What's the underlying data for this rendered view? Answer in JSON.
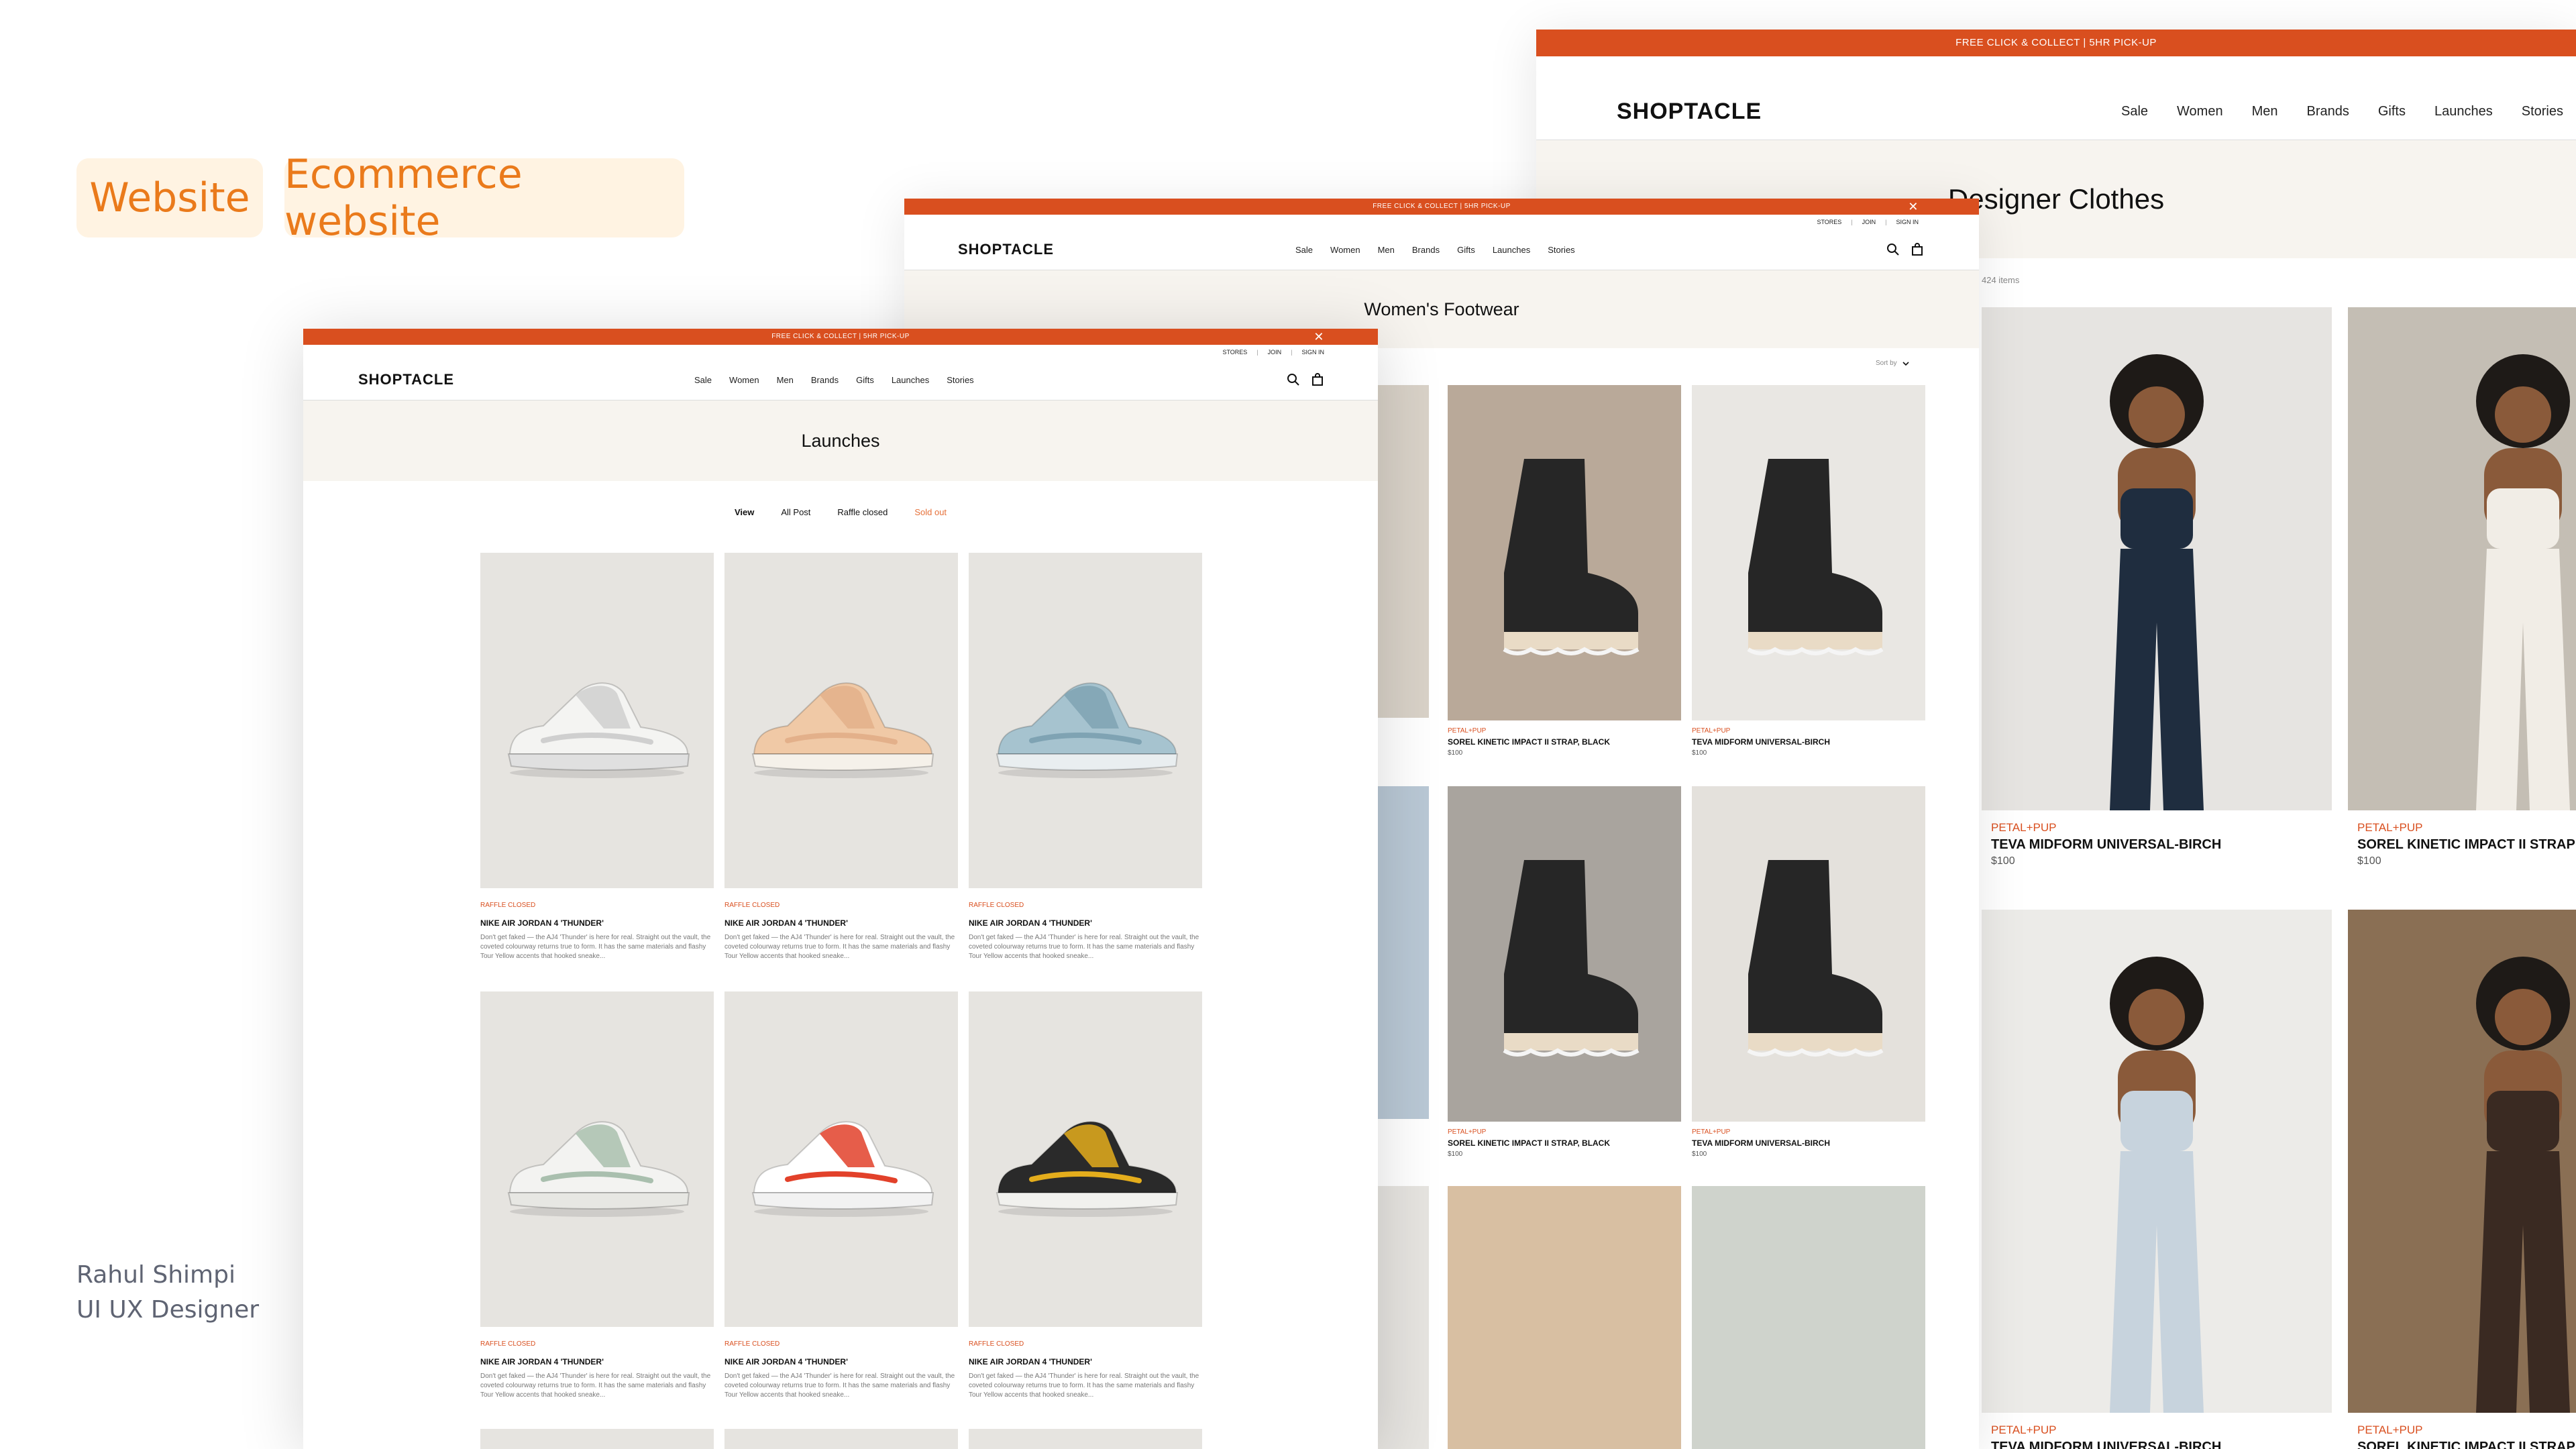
{
  "tags": [
    "Website",
    "Ecommerce website"
  ],
  "author": {
    "name": "Rahul Shimpi",
    "role": "UI UX Designer"
  },
  "store": {
    "promo": "FREE CLICK & COLLECT | 5HR PICK-UP",
    "logo": "SHOPTACLE",
    "util": [
      "STORES",
      "JOIN",
      "SIGN IN"
    ],
    "menu": [
      "Sale",
      "Women",
      "Men",
      "Brands",
      "Gifts",
      "Launches",
      "Stories"
    ]
  },
  "launches": {
    "title": "Launches",
    "filters": [
      "View",
      "All Post",
      "Raffle closed",
      "Sold out"
    ],
    "cards": [
      {
        "status": "RAFFLE CLOSED",
        "name": "NIKE AIR JORDAN 4 'THUNDER'",
        "desc": "Don't get faked — the AJ4 'Thunder' is here for real. Straight out the vault, the coveted colourway returns true to form. It has the same materials and flashy Tour Yellow accents that hooked sneake...",
        "shoe": "white",
        "colors": {
          "upper": "#f4f4f2",
          "accent": "#cfcfcf",
          "sole": "#e0e0e0"
        }
      },
      {
        "status": "RAFFLE CLOSED",
        "name": "NIKE AIR JORDAN 4 'THUNDER'",
        "desc": "Don't get faked — the AJ4 'Thunder' is here for real. Straight out the vault, the coveted colourway returns true to form. It has the same materials and flashy Tour Yellow accents that hooked sneake...",
        "shoe": "tan",
        "colors": {
          "upper": "#f0c9a6",
          "accent": "#e3b08a",
          "sole": "#f5f1ea"
        }
      },
      {
        "status": "RAFFLE CLOSED",
        "name": "NIKE AIR JORDAN 4 'THUNDER'",
        "desc": "Don't get faked — the AJ4 'Thunder' is here for real. Straight out the vault, the coveted colourway returns true to form. It has the same materials and flashy Tour Yellow accents that hooked sneake...",
        "shoe": "blue",
        "colors": {
          "upper": "#a6c3cf",
          "accent": "#7fa3b3",
          "sole": "#e9eef0"
        }
      },
      {
        "status": "RAFFLE CLOSED",
        "name": "NIKE AIR JORDAN 4 'THUNDER'",
        "desc": "Don't get faked — the AJ4 'Thunder' is here for real. Straight out the vault, the coveted colourway returns true to form. It has the same materials and flashy Tour Yellow accents that hooked sneake...",
        "shoe": "sage",
        "colors": {
          "upper": "#f3f3f1",
          "accent": "#a9bfae",
          "sole": "#e7e7e3"
        }
      },
      {
        "status": "RAFFLE CLOSED",
        "name": "NIKE AIR JORDAN 4 'THUNDER'",
        "desc": "Don't get faked — the AJ4 'Thunder' is here for real. Straight out the vault, the coveted colourway returns true to form. It has the same materials and flashy Tour Yellow accents that hooked sneake...",
        "shoe": "red",
        "colors": {
          "upper": "#ffffff",
          "accent": "#e2412a",
          "sole": "#f2f2f2"
        }
      },
      {
        "status": "RAFFLE CLOSED",
        "name": "NIKE AIR JORDAN 4 'THUNDER'",
        "desc": "Don't get faked — the AJ4 'Thunder' is here for real. Straight out the vault, the coveted colourway returns true to form. It has the same materials and flashy Tour Yellow accents that hooked sneake...",
        "shoe": "yellow",
        "colors": {
          "upper": "#2a2a2a",
          "accent": "#e4ad1c",
          "sole": "#f1f1ee"
        }
      }
    ]
  },
  "footwear": {
    "title": "Women's Footwear",
    "sort_label": "Sort by",
    "cards": [
      {
        "brand": "PETAL+PUP",
        "name": "SOREL KINETIC IMPACT II STRAP, BLACK",
        "price": "$100",
        "bg": "#b9a999"
      },
      {
        "brand": "PETAL+PUP",
        "name": "TEVA MIDFORM UNIVERSAL-BIRCH",
        "price": "$100",
        "bg": "#e9e7e3"
      },
      {
        "brand": "PETAL+PUP",
        "name": "SOREL KINETIC IMPACT II STRAP, BLACK",
        "price": "$100",
        "bg": "#a9a49e"
      },
      {
        "brand": "PETAL+PUP",
        "name": "TEVA MIDFORM UNIVERSAL-BIRCH",
        "price": "$100",
        "bg": "#e4e1dc"
      }
    ]
  },
  "designer": {
    "title": "Designer Clothes",
    "count": "424 items",
    "cards": [
      {
        "brand": "PETAL+PUP",
        "name": "TEVA MIDFORM UNIVERSAL-BIRCH",
        "price": "$100",
        "bg": "#e6e4e1",
        "outfit": "#1f2d3f"
      },
      {
        "brand": "PETAL+PUP",
        "name": "SOREL KINETIC IMPACT II STRAP",
        "price": "$100",
        "bg": "#c4beb4",
        "outfit": "#f1ede6"
      },
      {
        "brand": "PETAL+PUP",
        "name": "TEVA MIDFORM UNIVERSAL-BIRCH",
        "price": "",
        "bg": "#ecebe8",
        "outfit": "#c7d3dd"
      },
      {
        "brand": "PETAL+PUP",
        "name": "SOREL KINETIC IMPACT II STRAP",
        "price": "",
        "bg": "#8a6f54",
        "outfit": "#3a2a22"
      }
    ]
  }
}
